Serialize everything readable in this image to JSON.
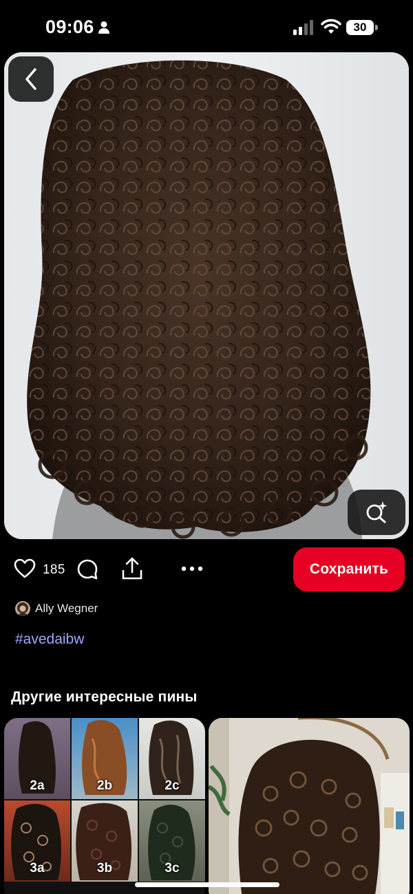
{
  "status_bar": {
    "time": "09:06",
    "battery": "30",
    "icons": [
      "person-icon",
      "signal-icon",
      "wifi-icon",
      "battery-icon"
    ]
  },
  "pin": {
    "icons": {
      "back": "chevron-left-icon",
      "lens": "visual-search-icon"
    }
  },
  "actions": {
    "likes": "185",
    "save_label": "Сохранить",
    "icons": [
      "heart-icon",
      "comment-icon",
      "share-icon",
      "more-icon"
    ]
  },
  "author": {
    "name": "Ally Wegner"
  },
  "hashtag": "#avedaibw",
  "related": {
    "title": "Другие интересные пины",
    "grid_labels": [
      "2a",
      "2b",
      "2c",
      "3a",
      "3b",
      "3c"
    ]
  },
  "colors": {
    "accent": "#e60023",
    "hashtag": "#9ea9ff",
    "background": "#000000"
  }
}
